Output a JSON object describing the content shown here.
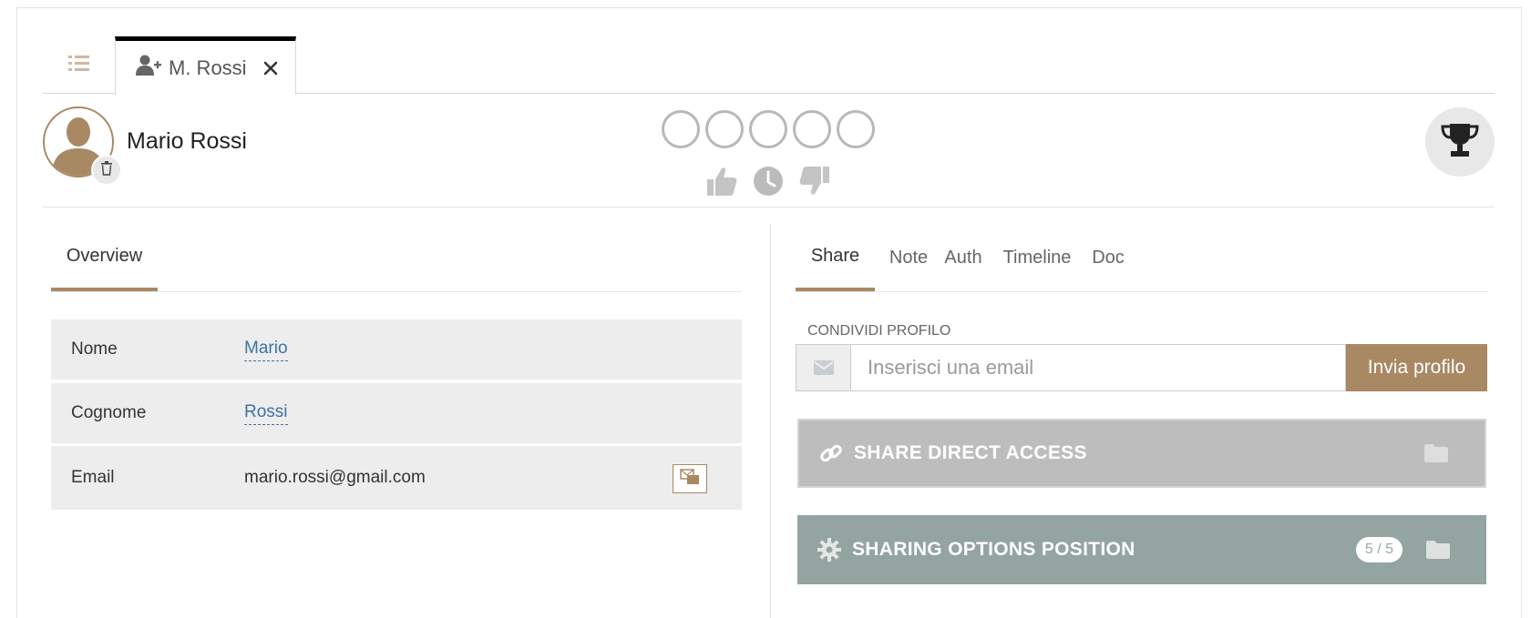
{
  "tabs": {
    "list_icon": "list-icon",
    "person_tab_label": "M. Rossi",
    "person_tab_icon": "user-plus-icon",
    "close_icon": "close-icon"
  },
  "header": {
    "name": "Mario Rossi",
    "rating_circles": 5,
    "vote_icons": [
      "thumbs-up-icon",
      "clock-icon",
      "thumbs-down-icon"
    ],
    "trophy_icon": "trophy-icon"
  },
  "left": {
    "tab_overview": "Overview",
    "fields": [
      {
        "label": "Nome",
        "value": "Mario"
      },
      {
        "label": "Cognome",
        "value": "Rossi"
      },
      {
        "label": "Email",
        "value": "mario.rossi@gmail.com"
      }
    ]
  },
  "right": {
    "tabs": [
      "Share",
      "Note",
      "Auth",
      "Timeline",
      "Doc"
    ],
    "share_label": "CONDIVIDI PROFILO",
    "email_placeholder": "Inserisci una email",
    "send_button": "Invia profilo",
    "panel_direct": "SHARE DIRECT ACCESS",
    "panel_options": "SHARING OPTIONS POSITION",
    "options_badge": "5 / 5"
  },
  "colors": {
    "accent": "#a98864",
    "link": "#3b73a8",
    "panel_grey": "#bdbdbd",
    "panel_teal": "#93a4a1"
  }
}
